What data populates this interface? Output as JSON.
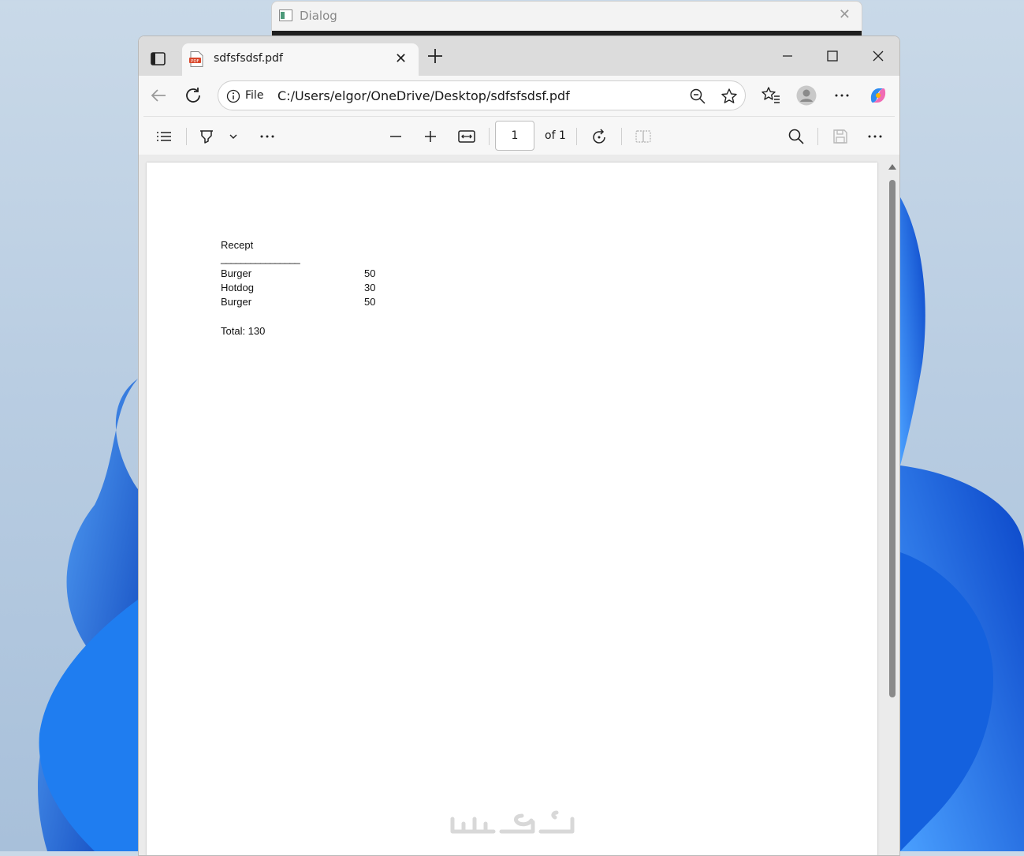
{
  "dialog": {
    "title": "Dialog"
  },
  "browser": {
    "tab_title": "sdfsfsdsf.pdf",
    "file_label": "File",
    "url": "C:/Users/elgor/OneDrive/Desktop/sdfsfsdsf.pdf"
  },
  "pdf_toolbar": {
    "page_value": "1",
    "page_of": "of 1"
  },
  "document": {
    "title": "Recept",
    "underline": "________________",
    "items": [
      {
        "name": "Burger",
        "price": "50"
      },
      {
        "name": "Hotdog",
        "price": "30"
      },
      {
        "name": "Burger",
        "price": "50"
      }
    ],
    "total": "Total: 130"
  },
  "watermark": "خمسات",
  "colors": {
    "accent": "#0067c0",
    "wallpaper_blue": "#1b6fe0",
    "pdf_badge": "#d9472b"
  }
}
